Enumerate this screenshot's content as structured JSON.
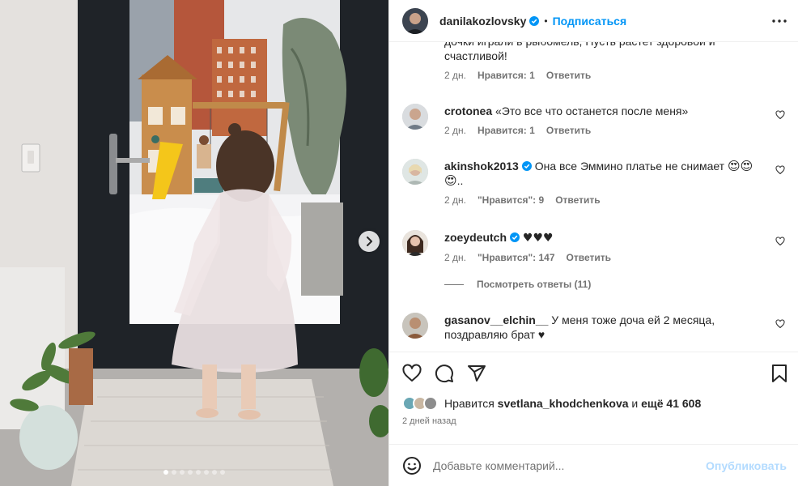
{
  "colors": {
    "accent": "#0095f6",
    "verified": "#0095f6",
    "muted": "#737373",
    "publish_disabled": "#b3dbff"
  },
  "post": {
    "author": "danilakozlovsky",
    "follow_label": "Подписаться",
    "separator": "•",
    "carousel_slides": 8,
    "active_slide": 1
  },
  "comments": [
    {
      "username": "",
      "text": "дочки играли в рыбомель, Пусть растет здоровой и счастливой!",
      "time": "2 дн.",
      "likes_label": "Нравится: 1",
      "reply_label": "Ответить",
      "truncated_top": true
    },
    {
      "username": "crotonea",
      "text": "«Это все что останется после меня»",
      "time": "2 дн.",
      "likes_label": "Нравится: 1",
      "reply_label": "Ответить"
    },
    {
      "username": "akinshok2013",
      "verified": true,
      "text_line1": "Она все Эммино платье не снимает",
      "emoji_line1": "😍😍",
      "emoji_line2": "😍",
      "text_tail": "..",
      "time": "2 дн.",
      "likes_label": "\"Нравится\": 9",
      "reply_label": "Ответить"
    },
    {
      "username": "zoeydeutch",
      "verified": true,
      "text": "♥♥♥",
      "time": "2 дн.",
      "likes_label": "\"Нравится\": 147",
      "reply_label": "Ответить",
      "view_replies_label": "Посмотреть ответы (11)"
    },
    {
      "username": "gasanov__elchin__",
      "text": "У меня тоже доча ей 2 месяца, поздравляю брат ♥"
    }
  ],
  "likes": {
    "prefix": "Нравится",
    "user": "svetlana_khodchenkova",
    "conjunction": "и",
    "rest": "ещё 41 608"
  },
  "posted_ago": "2 дней назад",
  "add_comment": {
    "placeholder": "Добавьте комментарий...",
    "publish_label": "Опубликовать"
  },
  "icons": {
    "more": "more-horizontal-icon",
    "like": "heart-outline-icon",
    "comment": "comment-bubble-icon",
    "share": "paper-plane-icon",
    "save": "bookmark-icon",
    "emoji": "smiley-icon",
    "next": "chevron-right-icon"
  }
}
